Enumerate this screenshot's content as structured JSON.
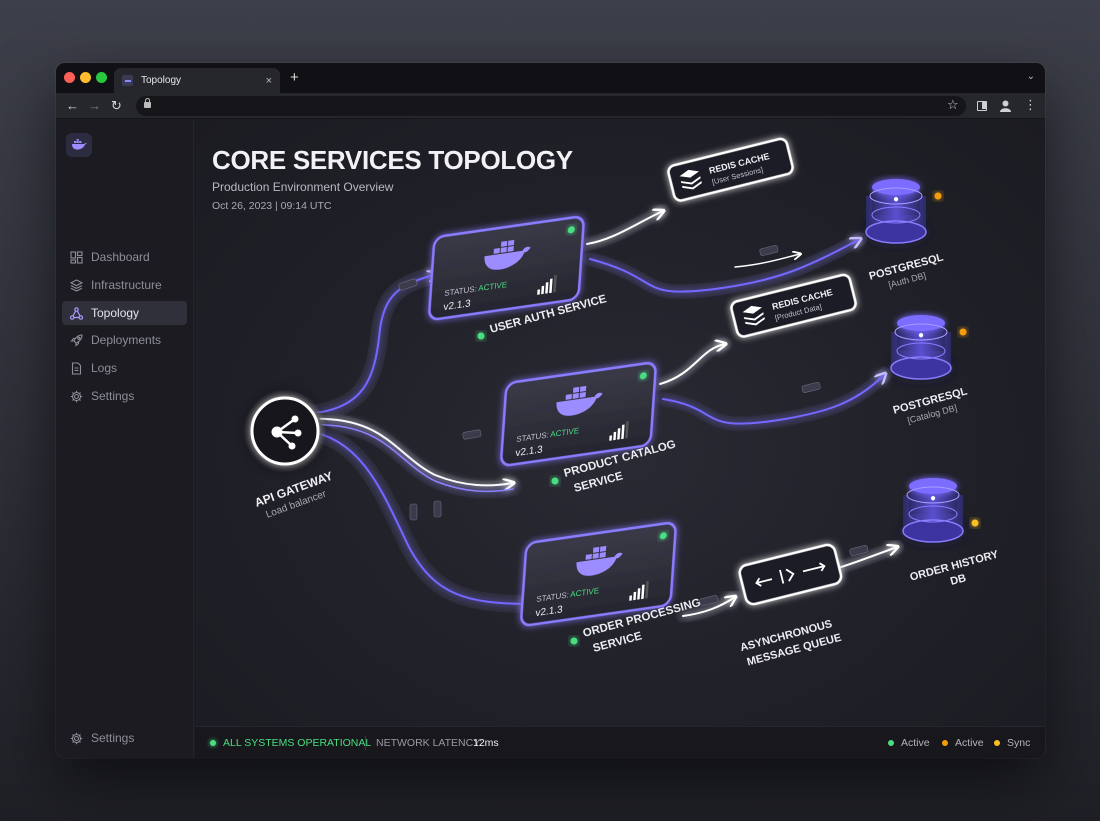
{
  "browser": {
    "tab_title": "Topology",
    "new_tab": "+",
    "tab_close": "×",
    "back": "←",
    "forward": "→",
    "reload": "↻",
    "star": "☆",
    "menu": "⋮"
  },
  "sidebar": {
    "items": [
      {
        "label": "Dashboard",
        "icon": "dashboard-icon"
      },
      {
        "label": "Infrastructure",
        "icon": "layers-icon"
      },
      {
        "label": "Topology",
        "icon": "topology-icon",
        "active": true
      },
      {
        "label": "Deployments",
        "icon": "rocket-icon"
      },
      {
        "label": "Logs",
        "icon": "file-icon"
      },
      {
        "label": "Settings",
        "icon": "gear-icon"
      }
    ],
    "footer_label": "Settings"
  },
  "header": {
    "title": "CORE SERVICES TOPOLOGY",
    "subtitle": "Production Environment Overview",
    "timestamp": "Oct 26, 2023 | 09:14 UTC"
  },
  "topology": {
    "gateway": {
      "name": "API GATEWAY",
      "desc": "Load balancer"
    },
    "services": [
      {
        "name": "USER AUTH SERVICE",
        "status_label": "STATUS:",
        "status_value": "ACTIVE",
        "version": "v2.1.3"
      },
      {
        "name_line1": "PRODUCT CATALOG",
        "name_line2": "SERVICE",
        "status_label": "STATUS:",
        "status_value": "ACTIVE",
        "version": "v2.1.3"
      },
      {
        "name_line1": "ORDER PROCESSING",
        "name_line2": "SERVICE",
        "status_label": "STATUS:",
        "status_value": "ACTIVE",
        "version": "v2.1.3"
      }
    ],
    "caches": [
      {
        "name": "REDIS CACHE",
        "desc": "[User Sessions]"
      },
      {
        "name": "REDIS CACHE",
        "desc": "[Product Data]"
      }
    ],
    "databases": [
      {
        "name": "POSTGRESQL",
        "desc": "[Auth DB]"
      },
      {
        "name": "POSTGRESQL",
        "desc": "[Catalog DB]"
      },
      {
        "name_line1": "ORDER HISTORY",
        "name_line2": "DB"
      }
    ],
    "queue": {
      "name_line1": "ASYNCHRONOUS",
      "name_line2": "MESSAGE QUEUE"
    }
  },
  "status_bar": {
    "system_status": "ALL SYSTEMS OPERATIONAL",
    "latency_label": "NETWORK LATENCY:",
    "latency_value": "12ms",
    "legend": [
      {
        "label": "Active",
        "color": "#4ade80"
      },
      {
        "label": "Active",
        "color": "#f59e0b"
      },
      {
        "label": "Sync",
        "color": "#fbbf24"
      }
    ]
  },
  "colors": {
    "accent": "#7c6cff",
    "active_green": "#4ade80",
    "warn_orange": "#f59e0b",
    "sync_yellow": "#fbbf24"
  }
}
